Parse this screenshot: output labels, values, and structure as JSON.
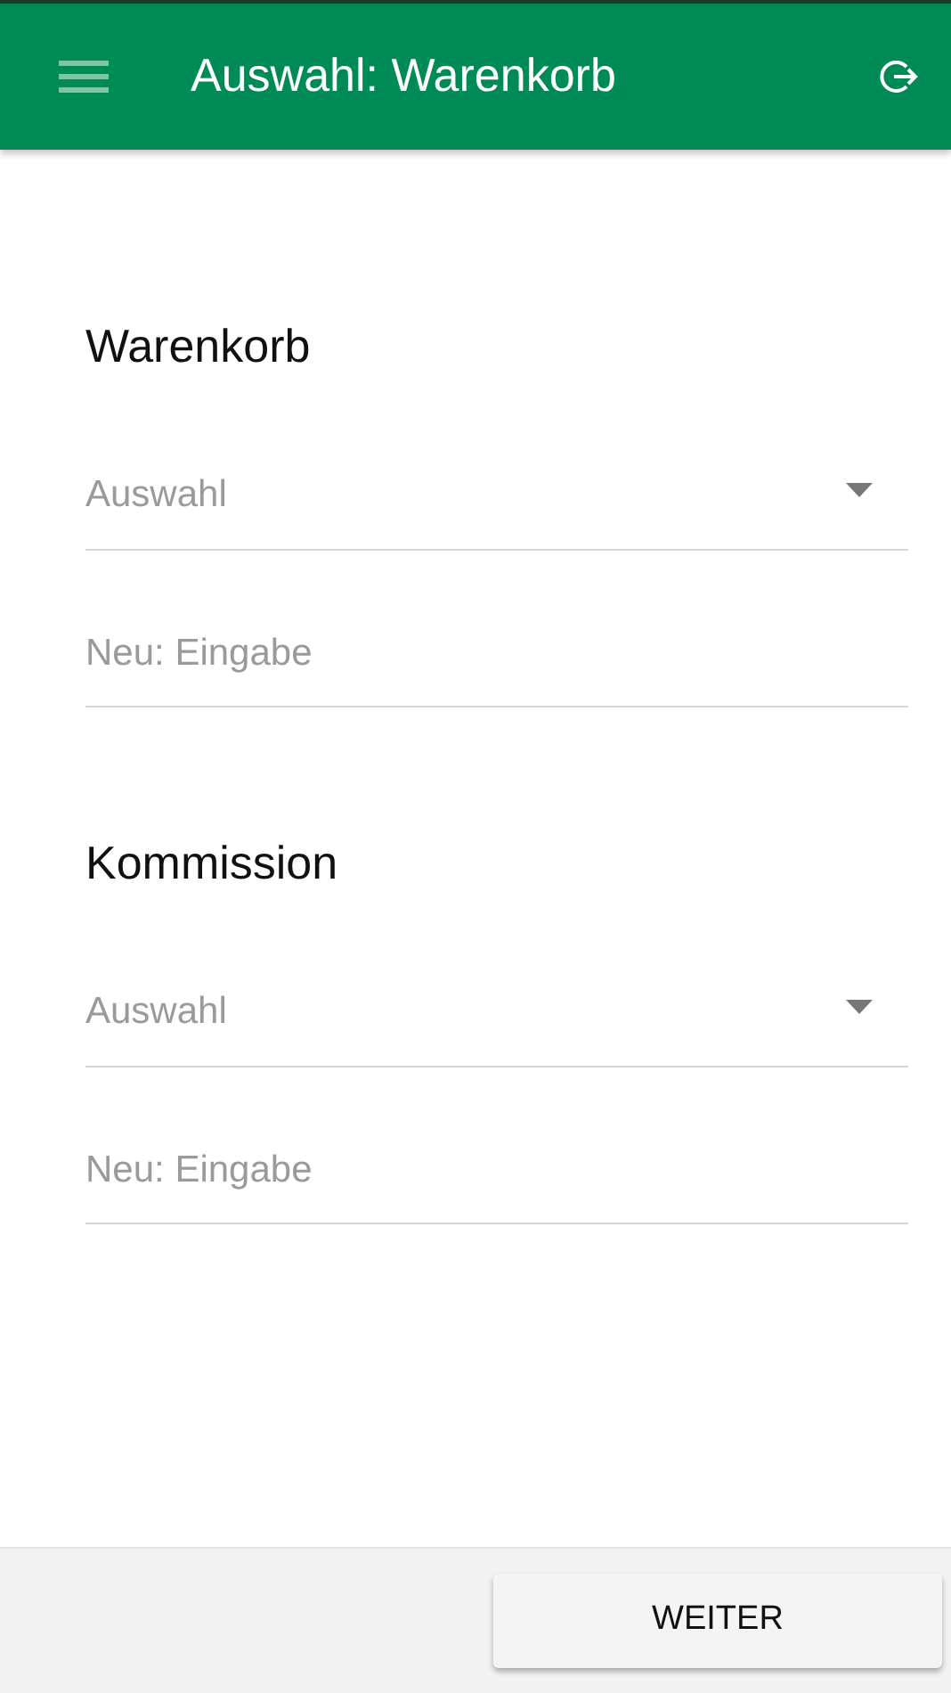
{
  "app_bar": {
    "title": "Auswahl: Warenkorb"
  },
  "sections": [
    {
      "heading": "Warenkorb",
      "select": {
        "placeholder": "Auswahl"
      },
      "input": {
        "placeholder": "Neu: Eingabe"
      }
    },
    {
      "heading": "Kommission",
      "select": {
        "placeholder": "Auswahl"
      },
      "input": {
        "placeholder": "Neu: Eingabe"
      }
    }
  ],
  "footer": {
    "button": "WEITER"
  }
}
